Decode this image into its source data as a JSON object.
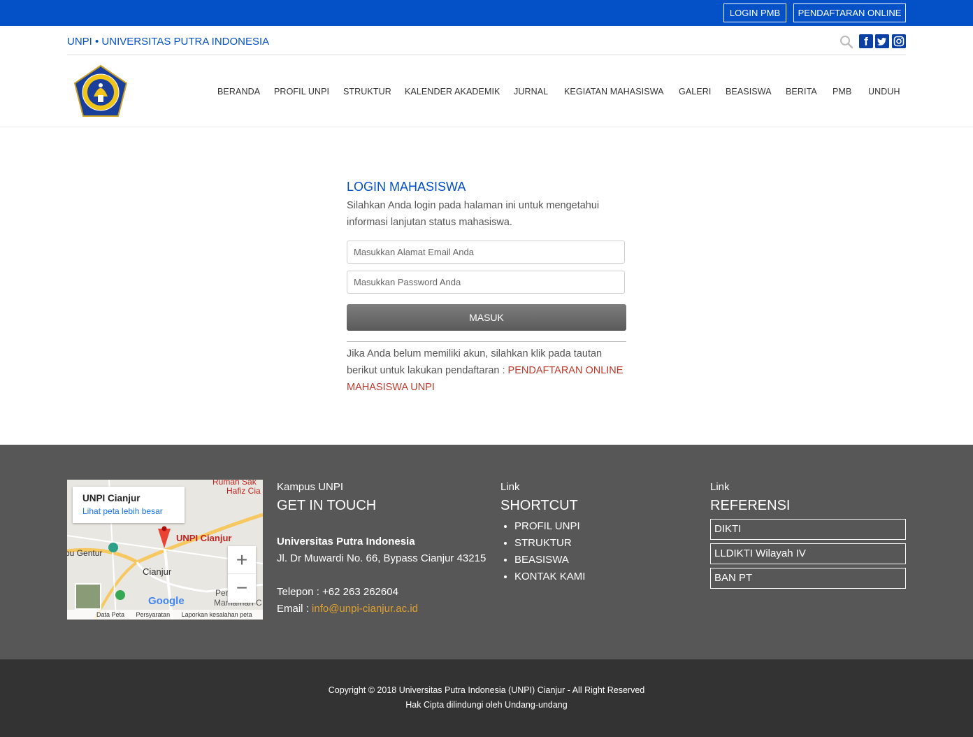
{
  "topbar": {
    "login_pmb": "LOGIN PMB",
    "pendaftaran_online": "PENDAFTARAN ONLINE",
    "bg_color": "#0451c7"
  },
  "header": {
    "site_title": "UNPI • UNIVERSITAS PUTRA INDONESIA",
    "icons": [
      "search-icon",
      "facebook-icon",
      "twitter-icon",
      "instagram-icon"
    ],
    "logo_text": "UNIVERSITAS PUTRA INDONESIA · UNPI CIANJUR"
  },
  "nav": {
    "items": [
      {
        "label": "BERANDA"
      },
      {
        "label": "PROFIL UNPI"
      },
      {
        "label": "STRUKTUR"
      },
      {
        "label": "KALENDER AKADEMIK"
      },
      {
        "label": "JURNAL"
      },
      {
        "label": "KEGIATAN MAHASISWA"
      },
      {
        "label": "GALERI"
      },
      {
        "label": "BEASISWA"
      },
      {
        "label": "BERITA"
      },
      {
        "label": "PMB"
      },
      {
        "label": "UNDUH"
      }
    ]
  },
  "login": {
    "title": "LOGIN MAHASISWA",
    "description": "Silahkan Anda login pada halaman ini untuk mengetahui informasi lanjutan status mahasiswa.",
    "email_placeholder": "Masukkan Alamat Email Anda",
    "email_value": "",
    "password_placeholder": "Masukkan Password Anda",
    "password_value": "",
    "submit_label": "MASUK",
    "register_text": "Jika Anda belum memiliki akun, silahkan klik pada tautan berikut untuk lakukan pendaftaran : ",
    "register_link": "PENDAFTARAN ONLINE MAHASISWA UNPI",
    "link_color": "#c0392b"
  },
  "map": {
    "place_title": "UNPI Cianjur",
    "larger_map_link": "Lihat peta lebih besar",
    "pin_label": "UNPI Cianjur",
    "city_label": "Cianjur",
    "google_label": "Google",
    "attribution": [
      "Data Peta",
      "Persyaratan",
      "Laporkan kesalahan peta"
    ],
    "zoom_in": "+",
    "zoom_out": "−",
    "labels": [
      "Rumah Sak",
      "Hafiz Cia",
      "pu Gentur",
      "Per",
      "Mamaman C"
    ]
  },
  "footer": {
    "contact": {
      "small": "Kampus UNPI",
      "heading": "GET IN TOUCH",
      "org_name": "Universitas Putra Indonesia",
      "address": "Jl. Dr Muwardi No. 66, Bypass Cianjur 43215",
      "phone": "Telepon : +62 263 262604",
      "email_label": "Email : ",
      "email": "info@unpi-cianjur.ac.id"
    },
    "shortcut": {
      "small": "Link",
      "heading": "SHORTCUT",
      "items": [
        "PROFIL UNPI",
        "STRUKTUR",
        "BEASISWA",
        "KONTAK KAMI"
      ]
    },
    "referensi": {
      "small": "Link",
      "heading": "REFERENSI",
      "items": [
        "DIKTI",
        "LLDIKTI Wilayah IV",
        "BAN PT"
      ]
    },
    "bg_color": "#575757"
  },
  "bottom": {
    "copyright": "Copyright © 2018 Universitas Putra Indonesia (UNPI) Cianjur - All Right Reserved",
    "notice": "Hak Cipta dilindungi oleh Undang-undang",
    "bg_color": "#333333"
  }
}
